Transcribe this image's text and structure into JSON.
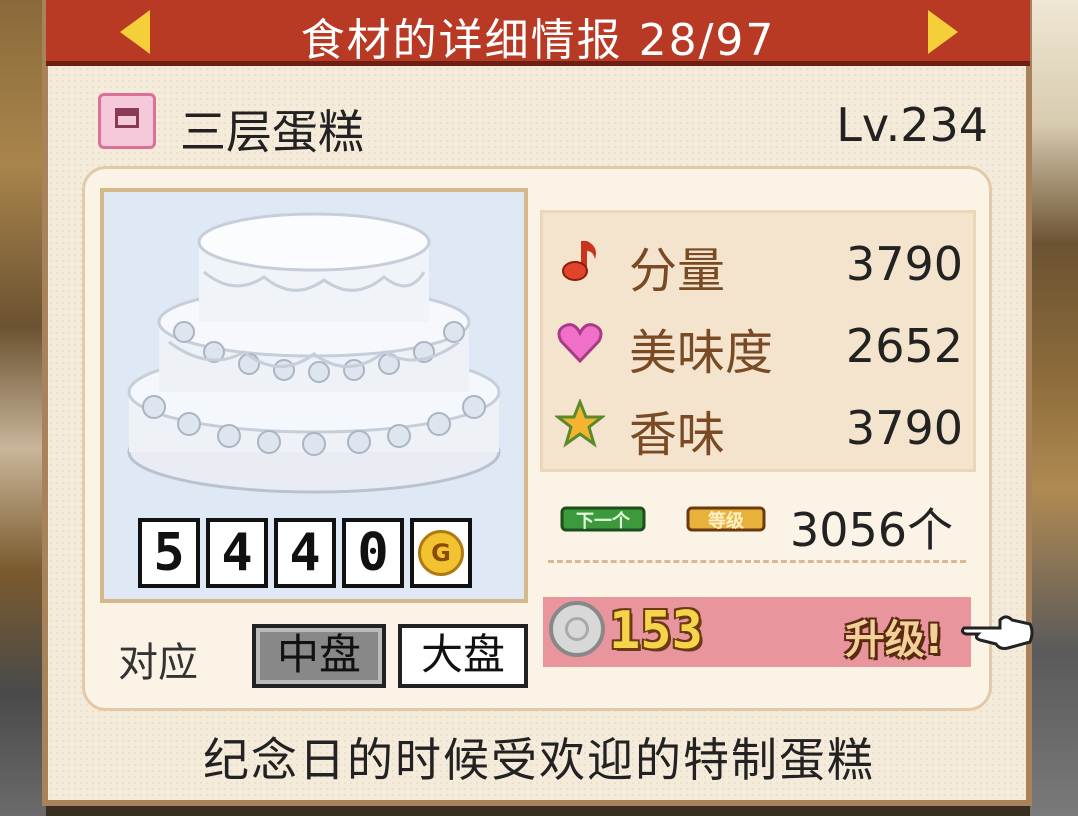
{
  "header": {
    "title": "食材的详细情报 28/97"
  },
  "item": {
    "name": "三层蛋糕",
    "level": "Lv.234",
    "price_digits": [
      "5",
      "4",
      "4",
      "0"
    ],
    "price_currency": "G"
  },
  "plates": {
    "label": "对应",
    "options": [
      "中盘",
      "大盘"
    ],
    "selected": "中盘"
  },
  "stats": [
    {
      "icon": "music-note-icon",
      "label": "分量",
      "value": "3790"
    },
    {
      "icon": "heart-icon",
      "label": "美味度",
      "value": "2652"
    },
    {
      "icon": "star-icon",
      "label": "香味",
      "value": "3790"
    }
  ],
  "next_level": {
    "badge_next": "下一个",
    "badge_level": "等级",
    "remaining": "3056个"
  },
  "upgrade": {
    "cost": "153",
    "label": "升级!"
  },
  "description": "纪念日的时候受欢迎的特制蛋糕",
  "colors": {
    "title_bar": "#b83a24",
    "arrow": "#f4cf3a",
    "upgrade_bar": "#e8959d",
    "panel": "#f5ebda"
  }
}
